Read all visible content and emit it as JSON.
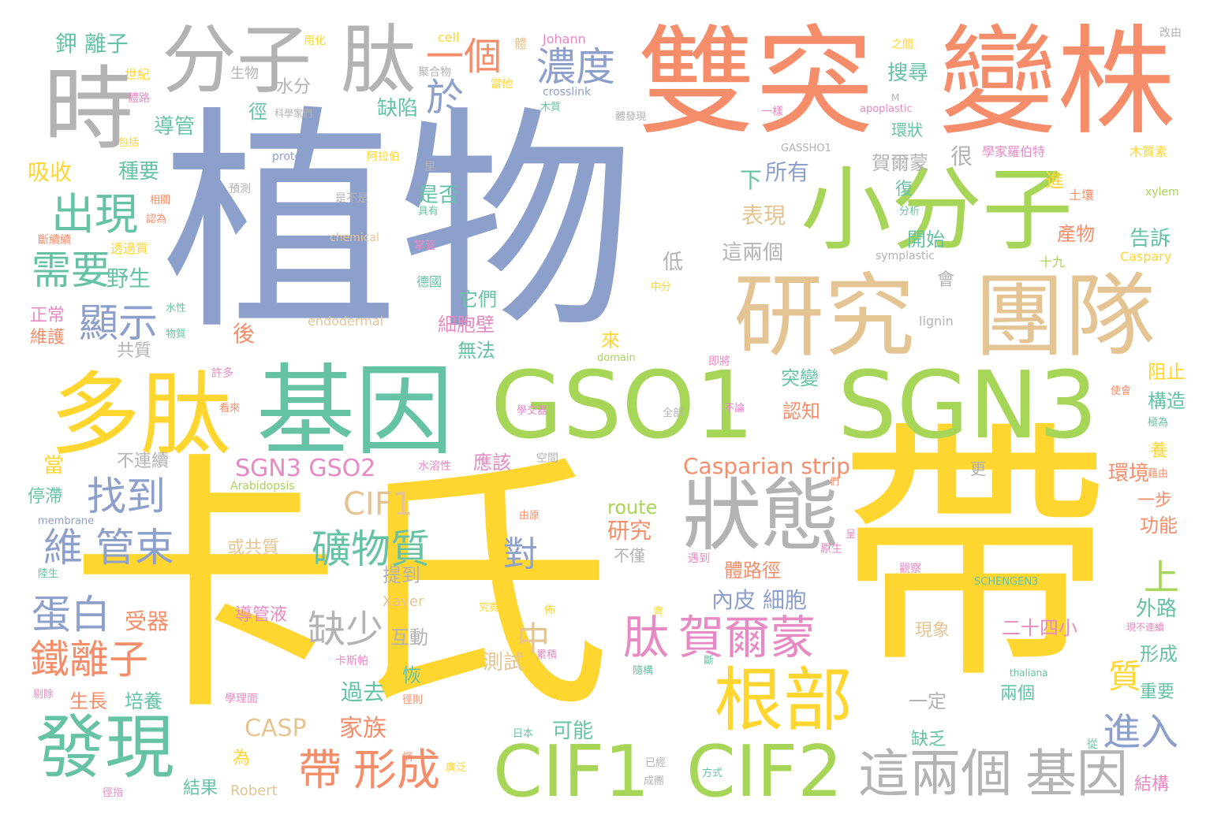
{
  "palette": {
    "orange": "#F68D6A",
    "green": "#A7D558",
    "blue": "#8D9FCB",
    "gold": "#FFD530",
    "teal": "#66C2A5",
    "pink": "#E78AC3",
    "tan": "#E5C494",
    "gray": "#B3B3B3"
  },
  "words": [
    {
      "text": "植物",
      "color": "blue"
    },
    {
      "text": "卡氏",
      "color": "gold"
    },
    {
      "text": "帶",
      "color": "gold"
    },
    {
      "text": "雙突",
      "color": "orange"
    },
    {
      "text": "變株",
      "color": "orange"
    },
    {
      "text": "小分子",
      "color": "green"
    },
    {
      "text": "研究",
      "color": "tan"
    },
    {
      "text": "團隊",
      "color": "tan"
    },
    {
      "text": "GSO1",
      "color": "green"
    },
    {
      "text": "SGN3",
      "color": "green"
    },
    {
      "text": "基因",
      "color": "teal"
    },
    {
      "text": "多肽",
      "color": "gold"
    },
    {
      "text": "時",
      "color": "gray"
    },
    {
      "text": "分子",
      "color": "gray"
    },
    {
      "text": "肽",
      "color": "gray"
    },
    {
      "text": "狀態",
      "color": "gray"
    },
    {
      "text": "CIF1",
      "color": "green"
    },
    {
      "text": "CIF2",
      "color": "green"
    },
    {
      "text": "根部",
      "color": "gold"
    },
    {
      "text": "發現",
      "color": "teal"
    },
    {
      "text": "這兩個",
      "color": "gray"
    },
    {
      "text": "基因",
      "color": "gray"
    },
    {
      "text": "出現",
      "color": "teal"
    },
    {
      "text": "需要",
      "color": "teal"
    },
    {
      "text": "一個",
      "color": "orange"
    },
    {
      "text": "濃度",
      "color": "blue"
    },
    {
      "text": "於",
      "color": "blue"
    },
    {
      "text": "顯示",
      "color": "blue"
    },
    {
      "text": "找到",
      "color": "blue"
    },
    {
      "text": "維 管束",
      "color": "blue"
    },
    {
      "text": "蛋白",
      "color": "blue"
    },
    {
      "text": "鐵離子",
      "color": "orange"
    },
    {
      "text": "礦物質",
      "color": "teal"
    },
    {
      "text": "肽",
      "color": "pink"
    },
    {
      "text": "賀爾蒙",
      "color": "pink"
    },
    {
      "text": "帶",
      "color": "orange"
    },
    {
      "text": "形成",
      "color": "orange"
    },
    {
      "text": "缺少",
      "color": "gray"
    },
    {
      "text": "中",
      "color": "tan"
    },
    {
      "text": "對",
      "color": "blue"
    },
    {
      "text": "CIF1",
      "color": "tan"
    },
    {
      "text": "SGN3 GSO2",
      "color": "pink"
    },
    {
      "text": "Casparian strip",
      "color": "orange"
    },
    {
      "text": "CASP",
      "color": "tan"
    },
    {
      "text": "家族",
      "color": "orange"
    },
    {
      "text": "進入",
      "color": "blue"
    },
    {
      "text": "上",
      "color": "green"
    },
    {
      "text": "質",
      "color": "gold"
    },
    {
      "text": "鉀 離子",
      "color": "teal"
    },
    {
      "text": "吸收",
      "color": "gold"
    },
    {
      "text": "生物",
      "color": "gray"
    },
    {
      "text": "世紀",
      "color": "gold"
    },
    {
      "text": "導管",
      "color": "teal"
    },
    {
      "text": "種要",
      "color": "teal"
    },
    {
      "text": "水分",
      "color": "gray"
    },
    {
      "text": "徑",
      "color": "teal"
    },
    {
      "text": "缺陷",
      "color": "teal"
    },
    {
      "text": "搜尋",
      "color": "teal"
    },
    {
      "text": "環狀",
      "color": "teal"
    },
    {
      "text": "賀爾蒙",
      "color": "gray"
    },
    {
      "text": "很",
      "color": "gray"
    },
    {
      "text": "所有",
      "color": "blue"
    },
    {
      "text": "下",
      "color": "teal"
    },
    {
      "text": "是否",
      "color": "teal"
    },
    {
      "text": "進",
      "color": "gold"
    },
    {
      "text": "表現",
      "color": "tan"
    },
    {
      "text": "開始",
      "color": "teal"
    },
    {
      "text": "產物",
      "color": "orange"
    },
    {
      "text": "告訴",
      "color": "teal"
    },
    {
      "text": "這兩個",
      "color": "gray"
    },
    {
      "text": "低",
      "color": "gray"
    },
    {
      "text": "野生",
      "color": "teal"
    },
    {
      "text": "它們",
      "color": "teal"
    },
    {
      "text": "細胞壁",
      "color": "pink"
    },
    {
      "text": "無法",
      "color": "teal"
    },
    {
      "text": "後",
      "color": "orange"
    },
    {
      "text": "來",
      "color": "gold"
    },
    {
      "text": "正常",
      "color": "pink"
    },
    {
      "text": "維護",
      "color": "orange"
    },
    {
      "text": "共質",
      "color": "gray"
    },
    {
      "text": "突變",
      "color": "teal"
    },
    {
      "text": "認知",
      "color": "orange"
    },
    {
      "text": "阻止",
      "color": "gold"
    },
    {
      "text": "構造",
      "color": "teal"
    },
    {
      "text": "不連續",
      "color": "gray"
    },
    {
      "text": "當",
      "color": "gold"
    },
    {
      "text": "停滯",
      "color": "teal"
    },
    {
      "text": "應該",
      "color": "pink"
    },
    {
      "text": "環境",
      "color": "orange"
    },
    {
      "text": "一步",
      "color": "orange"
    },
    {
      "text": "功能",
      "color": "orange"
    },
    {
      "text": "route",
      "color": "green"
    },
    {
      "text": "研究",
      "color": "orange"
    },
    {
      "text": "不僅",
      "color": "gray"
    },
    {
      "text": "或共質",
      "color": "tan"
    },
    {
      "text": "提到",
      "color": "gray"
    },
    {
      "text": "體路徑",
      "color": "orange"
    },
    {
      "text": "內皮 細胞",
      "color": "blue"
    },
    {
      "text": "外路",
      "color": "teal"
    },
    {
      "text": "受器",
      "color": "orange"
    },
    {
      "text": "導管液",
      "color": "pink"
    },
    {
      "text": "Xaver",
      "color": "tan"
    },
    {
      "text": "互動",
      "color": "gray"
    },
    {
      "text": "二十四小",
      "color": "pink"
    },
    {
      "text": "現象",
      "color": "tan"
    },
    {
      "text": "形成",
      "color": "teal"
    },
    {
      "text": "生長",
      "color": "orange"
    },
    {
      "text": "培養",
      "color": "teal"
    },
    {
      "text": "恢",
      "color": "teal"
    },
    {
      "text": "測試",
      "color": "tan"
    },
    {
      "text": "過去",
      "color": "teal"
    },
    {
      "text": "一定",
      "color": "gray"
    },
    {
      "text": "兩個",
      "color": "teal"
    },
    {
      "text": "重要",
      "color": "teal"
    },
    {
      "text": "可能",
      "color": "teal"
    },
    {
      "text": "缺乏",
      "color": "teal"
    },
    {
      "text": "結構",
      "color": "pink"
    },
    {
      "text": "為",
      "color": "gold"
    },
    {
      "text": "結果",
      "color": "teal"
    },
    {
      "text": "Robert",
      "color": "tan"
    },
    {
      "text": "用化",
      "color": "gold"
    },
    {
      "text": "cell",
      "color": "gold"
    },
    {
      "text": "Johann",
      "color": "pink"
    },
    {
      "text": "之間",
      "color": "gold"
    },
    {
      "text": "改由",
      "color": "gray"
    },
    {
      "text": "聚合物",
      "color": "gray"
    },
    {
      "text": "當他",
      "color": "gold"
    },
    {
      "text": "crosslink",
      "color": "blue"
    },
    {
      "text": "科學家們",
      "color": "gray"
    },
    {
      "text": "木質",
      "color": "teal"
    },
    {
      "text": "體發現",
      "color": "gray"
    },
    {
      "text": "一樣",
      "color": "pink"
    },
    {
      "text": "apoplastic",
      "color": "pink"
    },
    {
      "text": "M",
      "color": "gray"
    },
    {
      "text": "GASSHO1",
      "color": "gray"
    },
    {
      "text": "protein",
      "color": "blue"
    },
    {
      "text": "阿拉伯",
      "color": "gold"
    },
    {
      "text": "學家羅伯特",
      "color": "pink"
    },
    {
      "text": "木質素",
      "color": "gold"
    },
    {
      "text": "預測",
      "color": "gray"
    },
    {
      "text": "是不是",
      "color": "gray"
    },
    {
      "text": "復",
      "color": "teal"
    },
    {
      "text": "土壤",
      "color": "orange"
    },
    {
      "text": "xylem",
      "color": "green"
    },
    {
      "text": "分析",
      "color": "teal"
    },
    {
      "text": "chemical",
      "color": "tan"
    },
    {
      "text": "symplastic",
      "color": "gray"
    },
    {
      "text": "Caspary",
      "color": "gold"
    },
    {
      "text": "十九",
      "color": "green"
    },
    {
      "text": "中分",
      "color": "gold"
    },
    {
      "text": "會",
      "color": "gray"
    },
    {
      "text": "endodermal",
      "color": "tan"
    },
    {
      "text": "lignin",
      "color": "gray"
    },
    {
      "text": "domain",
      "color": "green"
    },
    {
      "text": "即將",
      "color": "pink"
    },
    {
      "text": "Arabidopsis",
      "color": "green"
    },
    {
      "text": "membrane",
      "color": "blue"
    },
    {
      "text": "SCHENGEN3",
      "color": "teal"
    },
    {
      "text": "卡斯帕",
      "color": "pink"
    },
    {
      "text": "學理面",
      "color": "pink"
    },
    {
      "text": "更",
      "color": "gray"
    },
    {
      "text": "原生",
      "color": "pink"
    },
    {
      "text": "觀察",
      "color": "pink"
    },
    {
      "text": "遇到",
      "color": "pink"
    },
    {
      "text": "水溶性",
      "color": "pink"
    },
    {
      "text": "空間",
      "color": "gray"
    },
    {
      "text": "許多",
      "color": "pink"
    },
    {
      "text": "水性",
      "color": "teal"
    },
    {
      "text": "物質",
      "color": "teal"
    },
    {
      "text": "包括",
      "color": "gold"
    },
    {
      "text": "體路",
      "color": "pink"
    },
    {
      "text": "相關",
      "color": "orange"
    },
    {
      "text": "認為",
      "color": "orange"
    },
    {
      "text": "斷續續",
      "color": "orange"
    },
    {
      "text": "透過質",
      "color": "gold"
    },
    {
      "text": "具有",
      "color": "teal"
    },
    {
      "text": "掌管",
      "color": "pink"
    },
    {
      "text": "德國",
      "color": "teal"
    },
    {
      "text": "里",
      "color": "gray"
    },
    {
      "text": "不論",
      "color": "pink"
    },
    {
      "text": "全部",
      "color": "gray"
    },
    {
      "text": "看來",
      "color": "orange"
    },
    {
      "text": "學交器",
      "color": "pink"
    },
    {
      "text": "使會",
      "color": "orange"
    },
    {
      "text": "極為",
      "color": "teal"
    },
    {
      "text": "藉由",
      "color": "orange"
    },
    {
      "text": "養",
      "color": "gold"
    },
    {
      "text": "呈",
      "color": "pink"
    },
    {
      "text": "由原",
      "color": "orange"
    },
    {
      "text": "們",
      "color": "orange"
    },
    {
      "text": "陸生",
      "color": "teal"
    },
    {
      "text": "究竟",
      "color": "gold"
    },
    {
      "text": "佈",
      "color": "gold"
    },
    {
      "text": "齊",
      "color": "gold"
    },
    {
      "text": "累積",
      "color": "pink"
    },
    {
      "text": "斷",
      "color": "teal"
    },
    {
      "text": "隨構",
      "color": "teal"
    },
    {
      "text": "thaliana",
      "color": "teal"
    },
    {
      "text": "現不連續",
      "color": "pink"
    },
    {
      "text": "剔除",
      "color": "pink"
    },
    {
      "text": "徑則",
      "color": "orange"
    },
    {
      "text": "日本",
      "color": "teal"
    },
    {
      "text": "廣泛",
      "color": "gold"
    },
    {
      "text": "從",
      "color": "teal"
    },
    {
      "text": "已經",
      "color": "gray"
    },
    {
      "text": "方式",
      "color": "teal"
    },
    {
      "text": "成團",
      "color": "gray"
    },
    {
      "text": "網",
      "color": "orange"
    },
    {
      "text": "徑指",
      "color": "pink"
    },
    {
      "text": "體",
      "color": "tan"
    }
  ]
}
